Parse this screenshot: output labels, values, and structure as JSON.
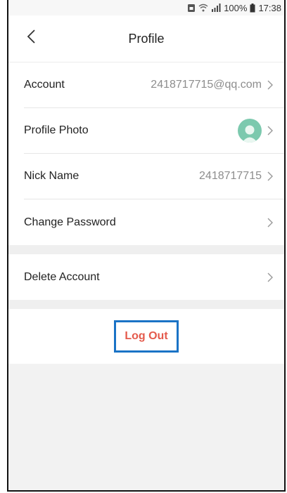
{
  "status_bar": {
    "battery_percent": "100%",
    "time": "17:38",
    "icons": [
      "sim-icon",
      "wifi-icon",
      "signal-icon",
      "battery-icon"
    ]
  },
  "header": {
    "title": "Profile",
    "back_icon": "chevron-left-icon"
  },
  "rows": [
    {
      "label": "Account",
      "value": "2418717715@qq.com"
    },
    {
      "label": "Profile Photo",
      "value": ""
    },
    {
      "label": "Nick Name",
      "value": "2418717715"
    },
    {
      "label": "Change Password",
      "value": ""
    }
  ],
  "delete_row": {
    "label": "Delete Account"
  },
  "logout": {
    "label": "Log Out"
  },
  "colors": {
    "accent_red": "#e45a4c",
    "highlight_blue": "#1a73c6",
    "avatar_green": "#7cc9ae"
  }
}
